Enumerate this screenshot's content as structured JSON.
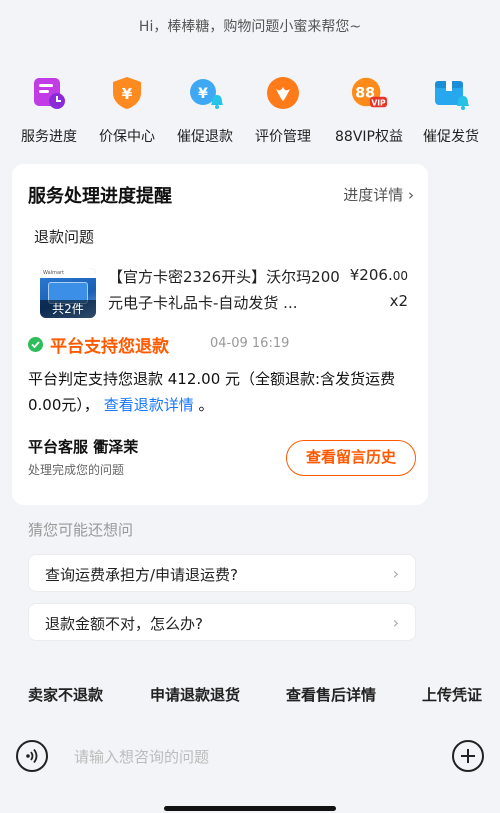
{
  "greeting": "Hi，棒棒糖，购物问题小蜜来帮您~",
  "shortcuts": [
    {
      "label": "服务进度",
      "icon": "service-progress-icon"
    },
    {
      "label": "价保中心",
      "icon": "price-protect-icon"
    },
    {
      "label": "催促退款",
      "icon": "urge-refund-icon"
    },
    {
      "label": "评价管理",
      "icon": "review-manage-icon"
    },
    {
      "label": "88VIP权益",
      "icon": "vip88-icon"
    },
    {
      "label": "催促发货",
      "icon": "urge-shipping-icon"
    }
  ],
  "progress_card": {
    "title": "服务处理进度提醒",
    "detail_link": "进度详情 ›",
    "section_label": "退款问题",
    "product": {
      "name": "【官方卡密2326开头】沃尔玛200元电子卡礼品卡-自动发货 ...",
      "price_main": "¥206.",
      "price_cents": "00",
      "qty": "x2",
      "count_badge": "共2件",
      "thumb_brand": "Walmart"
    },
    "status": {
      "text": "平台支持您退款",
      "time": "04-09 16:19"
    },
    "verdict_text": "平台判定支持您退款 412.00 元（全额退款:含发货运费0.00元），",
    "verdict_link": "查看退款详情",
    "verdict_end": "。",
    "service_name": "平台客服 衢泽茉",
    "service_sub": "处理完成您的问题",
    "history_button": "查看留言历史"
  },
  "guess": {
    "title": "猜您可能还想问",
    "items": [
      "查询运费承担方/申请退运费?",
      "退款金额不对，怎么办?"
    ]
  },
  "quick_actions": [
    "卖家不退款",
    "申请退款退货",
    "查看售后详情",
    "上传凭证"
  ],
  "input": {
    "placeholder": "请输入想咨询的问题"
  }
}
